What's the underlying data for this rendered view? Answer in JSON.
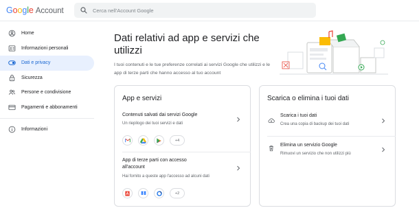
{
  "header": {
    "logo_letters": [
      "G",
      "o",
      "o",
      "g",
      "l",
      "e"
    ],
    "logo_suffix": "Account",
    "search_placeholder": "Cerca nell'Account Google"
  },
  "sidebar": {
    "items": [
      {
        "label": "Home",
        "icon": "home-icon",
        "active": false
      },
      {
        "label": "Informazioni personali",
        "icon": "id-card-icon",
        "active": false
      },
      {
        "label": "Dati e privacy",
        "icon": "toggle-icon",
        "active": true
      },
      {
        "label": "Sicurezza",
        "icon": "lock-icon",
        "active": false
      },
      {
        "label": "Persone e condivisione",
        "icon": "people-icon",
        "active": false
      },
      {
        "label": "Pagamenti e abbonamenti",
        "icon": "credit-card-icon",
        "active": false
      }
    ],
    "info_item": {
      "label": "Informazioni",
      "icon": "info-icon"
    }
  },
  "main": {
    "title": "Dati relativi ad app e servizi che utilizzi",
    "description": "I tuoi contenuti e le tue preferenze correlati ai servizi Google che utilizzi e le app di terze parti che hanno accesso al tuo account"
  },
  "apps_card": {
    "title": "App e servizi",
    "rows": [
      {
        "title": "Contenuti salvati dai servizi Google",
        "subtitle": "Un riepilogo dei tuoi servizi e dati",
        "icons": [
          "gmail-icon",
          "drive-icon",
          "play-icon"
        ],
        "more": "+4"
      },
      {
        "title": "App di terze parti con accesso all'account",
        "subtitle": "Hai fornito a queste app l'accesso ad alcuni dati",
        "icons": [
          "pdf-icon",
          "dropbox-icon",
          "circle-app-icon"
        ],
        "more": "+2"
      }
    ]
  },
  "download_card": {
    "title": "Scarica o elimina i tuoi dati",
    "rows": [
      {
        "title": "Scarica i tuoi dati",
        "subtitle": "Crea una copia di backup dei tuoi dati",
        "icon": "cloud-download-icon"
      },
      {
        "title": "Elimina un servizio Google",
        "subtitle": "Rimuovi un servizio che non utilizzi più",
        "icon": "trash-icon"
      }
    ]
  },
  "colors": {
    "active_bg": "#e8f0fe",
    "active_text": "#1967d2",
    "accent_blue": "#4285f4",
    "accent_red": "#ea4335",
    "accent_yellow": "#fbbc05",
    "accent_green": "#34a853"
  }
}
